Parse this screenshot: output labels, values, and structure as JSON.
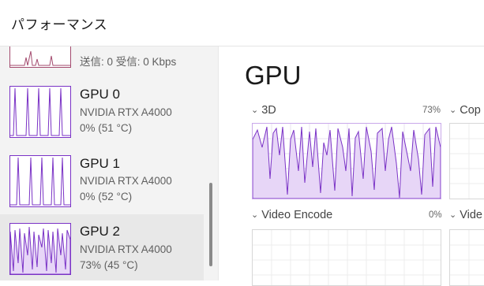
{
  "header": {
    "title": "パフォーマンス"
  },
  "sidebar": {
    "network": {
      "text": "送信: 0 受信: 0 Kbps"
    },
    "gpus": [
      {
        "name": "GPU 0",
        "model": "NVIDIA RTX A4000",
        "usage": "0% (51 °C)",
        "usage_value": 0,
        "temp_c": 51
      },
      {
        "name": "GPU 1",
        "model": "NVIDIA RTX A4000",
        "usage": "0% (52 °C)",
        "usage_value": 0,
        "temp_c": 52
      },
      {
        "name": "GPU 2",
        "model": "NVIDIA RTX A4000",
        "usage": "73% (45 °C)",
        "usage_value": 73,
        "temp_c": 45
      }
    ]
  },
  "main": {
    "title": "GPU",
    "graphs": [
      {
        "label": "3D",
        "percent": "73%"
      },
      {
        "label": "Cop"
      },
      {
        "label": "Video Encode",
        "percent": "0%"
      },
      {
        "label": "Vide"
      }
    ]
  },
  "colors": {
    "accent": "#7a32c6",
    "fill": "#e7d6f7",
    "grid": "#e3e3e3"
  }
}
